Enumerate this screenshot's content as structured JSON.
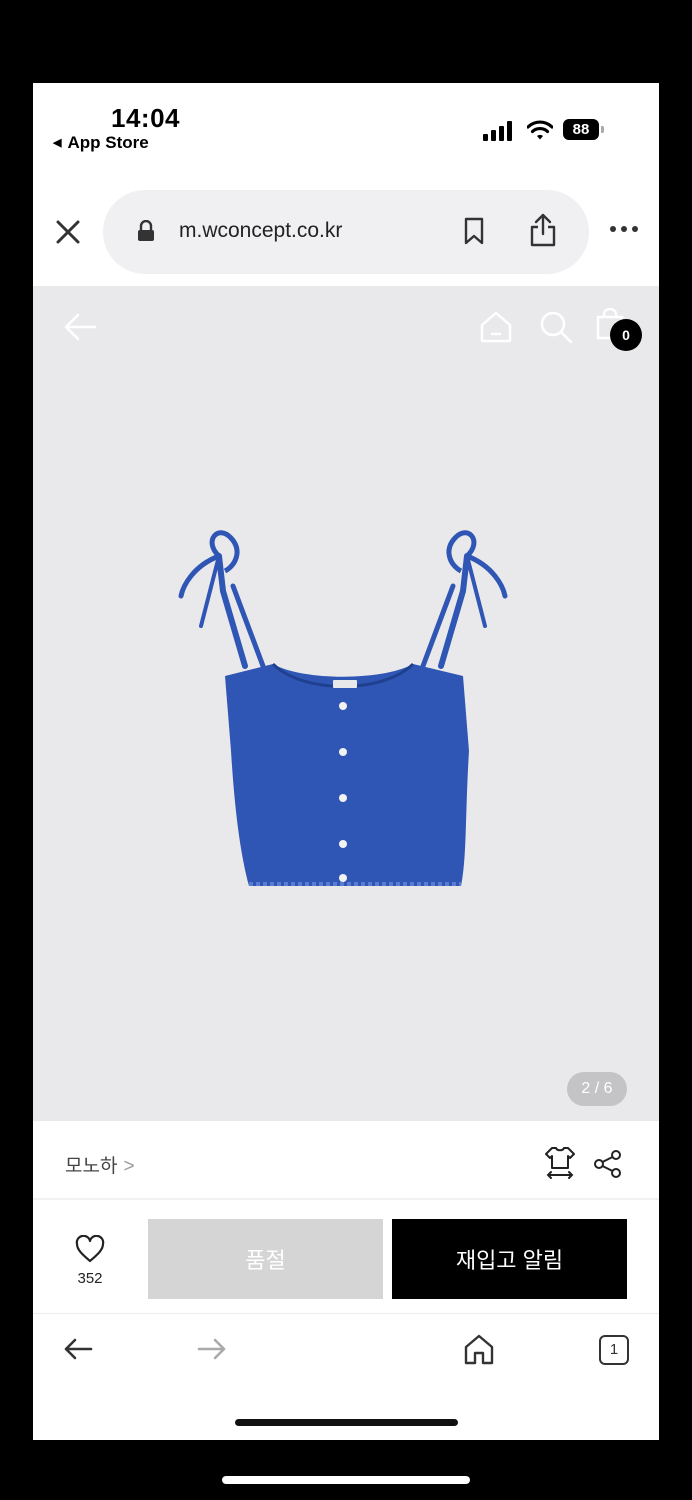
{
  "status_bar": {
    "time": "14:04",
    "back_app": "App Store",
    "battery": "88"
  },
  "browser": {
    "url": "m.wconcept.co.kr",
    "tab_count": "1"
  },
  "product": {
    "image_counter": "2 / 6",
    "cart_count": "0",
    "brand": "모노하",
    "like_count": "352",
    "colors": {
      "garment": "#2f56b4",
      "background": "#e9e9eb"
    }
  },
  "actions": {
    "sold_out_label": "품절",
    "restock_label": "재입고 알림"
  },
  "icons": [
    "close-icon",
    "lock-icon",
    "bookmark-icon",
    "share-icon",
    "more-icon",
    "back-arrow-icon",
    "home-icon",
    "search-icon",
    "bag-icon",
    "size-guide-icon",
    "share-nodes-icon",
    "heart-icon",
    "forward-arrow-icon",
    "tabs-icon"
  ]
}
